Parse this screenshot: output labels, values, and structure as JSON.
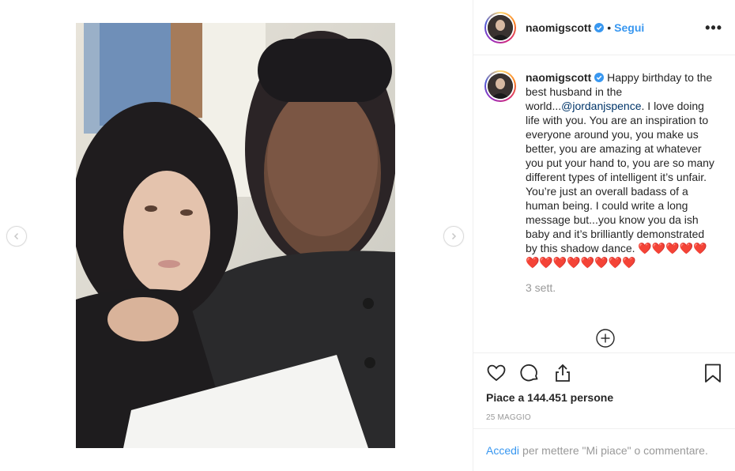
{
  "header": {
    "username": "naomigscott",
    "separator": "•",
    "follow_label": "Segui",
    "more_label": "•••"
  },
  "caption": {
    "username": "naomigscott",
    "text_before_mention": "Happy birthday to the best husband in the world...",
    "mention": "@jordanjspence",
    "text_after_mention": ". I love doing life with you. You are an inspiration to everyone around you, you make us better, you are amazing at whatever you put your hand to, you are so many different types of intelligent it’s unfair. You’re just an overall badass of a human being. I could write a long message but...you know you da ish baby and it’s brilliantly demonstrated by this shadow dance. ❤️❤️❤️❤️❤️❤️❤️❤️❤️❤️❤️❤️❤️",
    "time": "3 sett."
  },
  "actions": {
    "likes": "Piace a 144.451 persone",
    "date": "25 MAGGIO"
  },
  "login": {
    "link": "Accedi",
    "text": "per mettere \"Mi piace\" o commentare."
  },
  "colors": {
    "accent": "#3897f0",
    "mention": "#003569",
    "muted": "#999999",
    "border": "#efefef"
  },
  "icons": {
    "prev": "chevron-left-icon",
    "next": "chevron-right-icon",
    "verified": "verified-badge-icon",
    "like": "heart-icon",
    "comment": "comment-icon",
    "share": "share-icon",
    "save": "bookmark-icon",
    "add": "plus-circle-icon"
  }
}
